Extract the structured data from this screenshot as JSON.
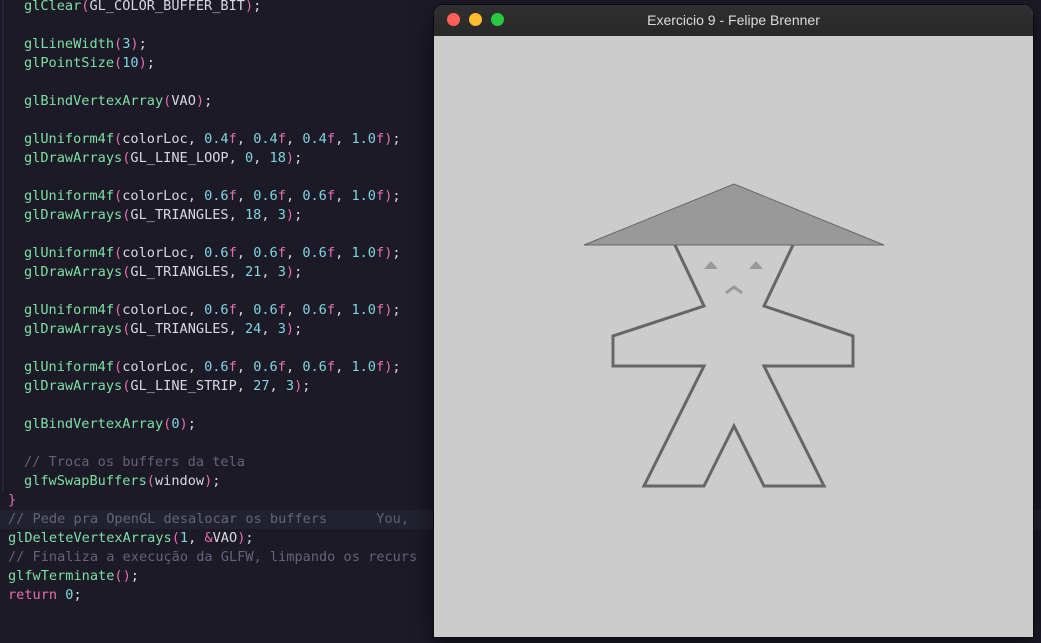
{
  "editor": {
    "lines": [
      {
        "y": -9,
        "indent": 24,
        "tokens": [
          [
            "fn",
            "glClear"
          ],
          [
            "pink",
            "("
          ],
          [
            "",
            "GL_COLOR_BUFFER_BIT"
          ],
          [
            "pink",
            ")"
          ],
          [
            "",
            ";"
          ]
        ]
      },
      {
        "y": 0,
        "tokens": []
      }
    ],
    "code": [
      {
        "row": 0,
        "x": 24,
        "t": [
          [
            "fn",
            "glClear"
          ],
          [
            "pink",
            "("
          ],
          [
            "",
            "GL_COLOR_BUFFER_BIT"
          ],
          [
            "pink",
            ")"
          ],
          [
            "",
            ";"
          ]
        ]
      },
      {
        "row": 2,
        "x": 24,
        "t": [
          [
            "fn",
            "glLineWidth"
          ],
          [
            "pink",
            "("
          ],
          [
            "num",
            "3"
          ],
          [
            "pink",
            ")"
          ],
          [
            "",
            ";"
          ]
        ]
      },
      {
        "row": 3,
        "x": 24,
        "t": [
          [
            "fn",
            "glPointSize"
          ],
          [
            "pink",
            "("
          ],
          [
            "num",
            "10"
          ],
          [
            "pink",
            ")"
          ],
          [
            "",
            ";"
          ]
        ]
      },
      {
        "row": 5,
        "x": 24,
        "t": [
          [
            "fn",
            "glBindVertexArray"
          ],
          [
            "pink",
            "("
          ],
          [
            "",
            "VAO"
          ],
          [
            "pink",
            ")"
          ],
          [
            "",
            ";"
          ]
        ]
      },
      {
        "row": 7,
        "x": 24,
        "t": [
          [
            "fn",
            "glUniform4f"
          ],
          [
            "pink",
            "("
          ],
          [
            "",
            "colorLoc, "
          ],
          [
            "num",
            "0.4"
          ],
          [
            "pink",
            "f"
          ],
          [
            "",
            ", "
          ],
          [
            "num",
            "0.4"
          ],
          [
            "pink",
            "f"
          ],
          [
            "",
            ", "
          ],
          [
            "num",
            "0.4"
          ],
          [
            "pink",
            "f"
          ],
          [
            "",
            ", "
          ],
          [
            "num",
            "1.0"
          ],
          [
            "pink",
            "f"
          ],
          [
            "pink",
            ")"
          ],
          [
            "",
            ";"
          ]
        ]
      },
      {
        "row": 8,
        "x": 24,
        "t": [
          [
            "fn",
            "glDrawArrays"
          ],
          [
            "pink",
            "("
          ],
          [
            "",
            "GL_LINE_LOOP, "
          ],
          [
            "num",
            "0"
          ],
          [
            "",
            ", "
          ],
          [
            "num",
            "18"
          ],
          [
            "pink",
            ")"
          ],
          [
            "",
            ";"
          ]
        ]
      },
      {
        "row": 10,
        "x": 24,
        "t": [
          [
            "fn",
            "glUniform4f"
          ],
          [
            "pink",
            "("
          ],
          [
            "",
            "colorLoc, "
          ],
          [
            "num",
            "0.6"
          ],
          [
            "pink",
            "f"
          ],
          [
            "",
            ", "
          ],
          [
            "num",
            "0.6"
          ],
          [
            "pink",
            "f"
          ],
          [
            "",
            ", "
          ],
          [
            "num",
            "0.6"
          ],
          [
            "pink",
            "f"
          ],
          [
            "",
            ", "
          ],
          [
            "num",
            "1.0"
          ],
          [
            "pink",
            "f"
          ],
          [
            "pink",
            ")"
          ],
          [
            "",
            ";"
          ]
        ]
      },
      {
        "row": 11,
        "x": 24,
        "t": [
          [
            "fn",
            "glDrawArrays"
          ],
          [
            "pink",
            "("
          ],
          [
            "",
            "GL_TRIANGLES, "
          ],
          [
            "num",
            "18"
          ],
          [
            "",
            ", "
          ],
          [
            "num",
            "3"
          ],
          [
            "pink",
            ")"
          ],
          [
            "",
            ";"
          ]
        ]
      },
      {
        "row": 13,
        "x": 24,
        "t": [
          [
            "fn",
            "glUniform4f"
          ],
          [
            "pink",
            "("
          ],
          [
            "",
            "colorLoc, "
          ],
          [
            "num",
            "0.6"
          ],
          [
            "pink",
            "f"
          ],
          [
            "",
            ", "
          ],
          [
            "num",
            "0.6"
          ],
          [
            "pink",
            "f"
          ],
          [
            "",
            ", "
          ],
          [
            "num",
            "0.6"
          ],
          [
            "pink",
            "f"
          ],
          [
            "",
            ", "
          ],
          [
            "num",
            "1.0"
          ],
          [
            "pink",
            "f"
          ],
          [
            "pink",
            ")"
          ],
          [
            "",
            ";"
          ]
        ]
      },
      {
        "row": 14,
        "x": 24,
        "t": [
          [
            "fn",
            "glDrawArrays"
          ],
          [
            "pink",
            "("
          ],
          [
            "",
            "GL_TRIANGLES, "
          ],
          [
            "num",
            "21"
          ],
          [
            "",
            ", "
          ],
          [
            "num",
            "3"
          ],
          [
            "pink",
            ")"
          ],
          [
            "",
            ";"
          ]
        ]
      },
      {
        "row": 16,
        "x": 24,
        "t": [
          [
            "fn",
            "glUniform4f"
          ],
          [
            "pink",
            "("
          ],
          [
            "",
            "colorLoc, "
          ],
          [
            "num",
            "0.6"
          ],
          [
            "pink",
            "f"
          ],
          [
            "",
            ", "
          ],
          [
            "num",
            "0.6"
          ],
          [
            "pink",
            "f"
          ],
          [
            "",
            ", "
          ],
          [
            "num",
            "0.6"
          ],
          [
            "pink",
            "f"
          ],
          [
            "",
            ", "
          ],
          [
            "num",
            "1.0"
          ],
          [
            "pink",
            "f"
          ],
          [
            "pink",
            ")"
          ],
          [
            "",
            ";"
          ]
        ]
      },
      {
        "row": 17,
        "x": 24,
        "t": [
          [
            "fn",
            "glDrawArrays"
          ],
          [
            "pink",
            "("
          ],
          [
            "",
            "GL_TRIANGLES, "
          ],
          [
            "num",
            "24"
          ],
          [
            "",
            ", "
          ],
          [
            "num",
            "3"
          ],
          [
            "pink",
            ")"
          ],
          [
            "",
            ";"
          ]
        ]
      },
      {
        "row": 19,
        "x": 24,
        "t": [
          [
            "fn",
            "glUniform4f"
          ],
          [
            "pink",
            "("
          ],
          [
            "",
            "colorLoc, "
          ],
          [
            "num",
            "0.6"
          ],
          [
            "pink",
            "f"
          ],
          [
            "",
            ", "
          ],
          [
            "num",
            "0.6"
          ],
          [
            "pink",
            "f"
          ],
          [
            "",
            ", "
          ],
          [
            "num",
            "0.6"
          ],
          [
            "pink",
            "f"
          ],
          [
            "",
            ", "
          ],
          [
            "num",
            "1.0"
          ],
          [
            "pink",
            "f"
          ],
          [
            "pink",
            ")"
          ],
          [
            "",
            ";"
          ]
        ]
      },
      {
        "row": 20,
        "x": 24,
        "t": [
          [
            "fn",
            "glDrawArrays"
          ],
          [
            "pink",
            "("
          ],
          [
            "",
            "GL_LINE_STRIP, "
          ],
          [
            "num",
            "27"
          ],
          [
            "",
            ", "
          ],
          [
            "num",
            "3"
          ],
          [
            "pink",
            ")"
          ],
          [
            "",
            ";"
          ]
        ]
      },
      {
        "row": 22,
        "x": 24,
        "t": [
          [
            "fn",
            "glBindVertexArray"
          ],
          [
            "pink",
            "("
          ],
          [
            "num",
            "0"
          ],
          [
            "pink",
            ")"
          ],
          [
            "",
            ";"
          ]
        ]
      },
      {
        "row": 24,
        "x": 24,
        "t": [
          [
            "cm",
            "// Troca os buffers da tela"
          ]
        ]
      },
      {
        "row": 25,
        "x": 24,
        "t": [
          [
            "fn",
            "glfwSwapBuffers"
          ],
          [
            "pink",
            "("
          ],
          [
            "",
            "window"
          ],
          [
            "pink",
            ")"
          ],
          [
            "",
            ";"
          ]
        ]
      },
      {
        "row": 26,
        "x": 8,
        "t": [
          [
            "pink",
            "}"
          ]
        ]
      },
      {
        "row": 27,
        "x": 8,
        "hl": true,
        "t": [
          [
            "cm",
            "// Pede pra OpenGL desalocar os buffers"
          ],
          [
            "blame",
            "      You, "
          ]
        ]
      },
      {
        "row": 28,
        "x": 8,
        "t": [
          [
            "fn",
            "glDeleteVertexArrays"
          ],
          [
            "pink",
            "("
          ],
          [
            "num",
            "1"
          ],
          [
            "",
            ", "
          ],
          [
            "pink",
            "&"
          ],
          [
            "",
            "VAO"
          ],
          [
            "pink",
            ")"
          ],
          [
            "",
            ";"
          ]
        ]
      },
      {
        "row": 29,
        "x": 8,
        "t": [
          [
            "cm",
            "// Finaliza a execução da GLFW, limpando os recurs"
          ]
        ]
      },
      {
        "row": 30,
        "x": 8,
        "t": [
          [
            "fn",
            "glfwTerminate"
          ],
          [
            "pink",
            "("
          ],
          [
            "pink",
            ")"
          ],
          [
            "",
            ";"
          ]
        ]
      },
      {
        "row": 31,
        "x": 8,
        "t": [
          [
            "kw",
            "return"
          ],
          [
            "",
            " "
          ],
          [
            "num",
            "0"
          ],
          [
            "",
            ";"
          ]
        ]
      }
    ]
  },
  "window": {
    "title": "Exercicio 9 - Felipe Brenner",
    "buttons": {
      "close": "#ff5f57",
      "minimize": "#febc2e",
      "maximize": "#28c840"
    },
    "clear_color": "#cccccc"
  },
  "scene": {
    "outline_color": "#666666",
    "fill_color": "#999999",
    "line_width": 3
  }
}
